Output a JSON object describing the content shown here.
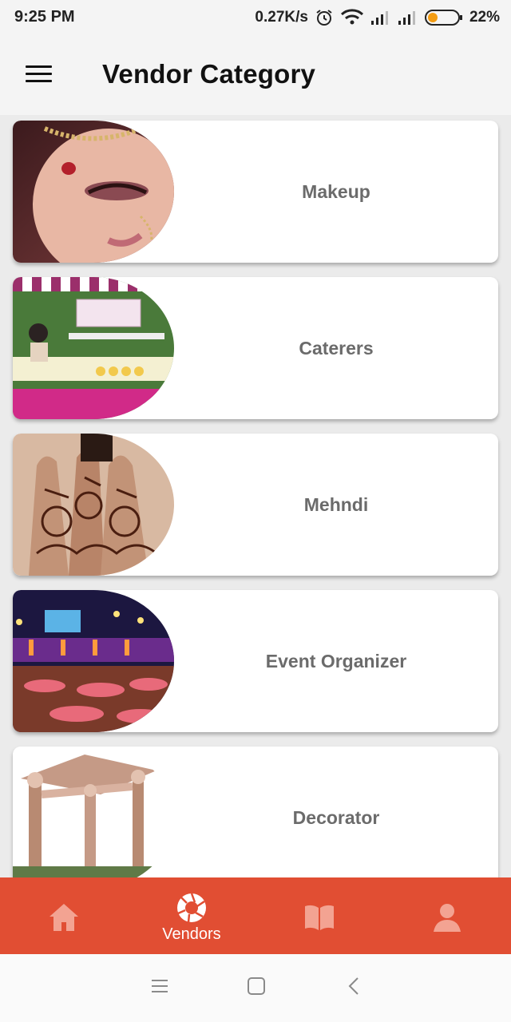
{
  "status_bar": {
    "time": "9:25 PM",
    "net_speed": "0.27K/s",
    "battery": "22%",
    "icons": [
      "alarm-icon",
      "wifi-icon",
      "signal-icon",
      "signal-icon",
      "battery-icon"
    ]
  },
  "app_bar": {
    "menu_icon": "hamburger-menu-icon",
    "title": "Vendor Category"
  },
  "categories": [
    {
      "label": "Makeup",
      "image": "bride-makeup-photo"
    },
    {
      "label": "Caterers",
      "image": "catering-stall-photo"
    },
    {
      "label": "Mehndi",
      "image": "mehndi-hands-photo"
    },
    {
      "label": "Event Organizer",
      "image": "event-hall-photo"
    },
    {
      "label": "Decorator",
      "image": "floral-mandap-photo"
    }
  ],
  "bottom_nav": {
    "items": [
      {
        "icon": "home-icon",
        "label": ""
      },
      {
        "icon": "aperture-icon",
        "label": "Vendors",
        "active": true
      },
      {
        "icon": "book-icon",
        "label": ""
      },
      {
        "icon": "person-icon",
        "label": ""
      }
    ]
  },
  "system_nav": {
    "icons": [
      "recents-menu-icon",
      "home-square-icon",
      "back-chevron-icon"
    ]
  },
  "colors": {
    "accent": "#e14e33",
    "card_text": "#6b6b6b",
    "background": "#ebebeb"
  }
}
